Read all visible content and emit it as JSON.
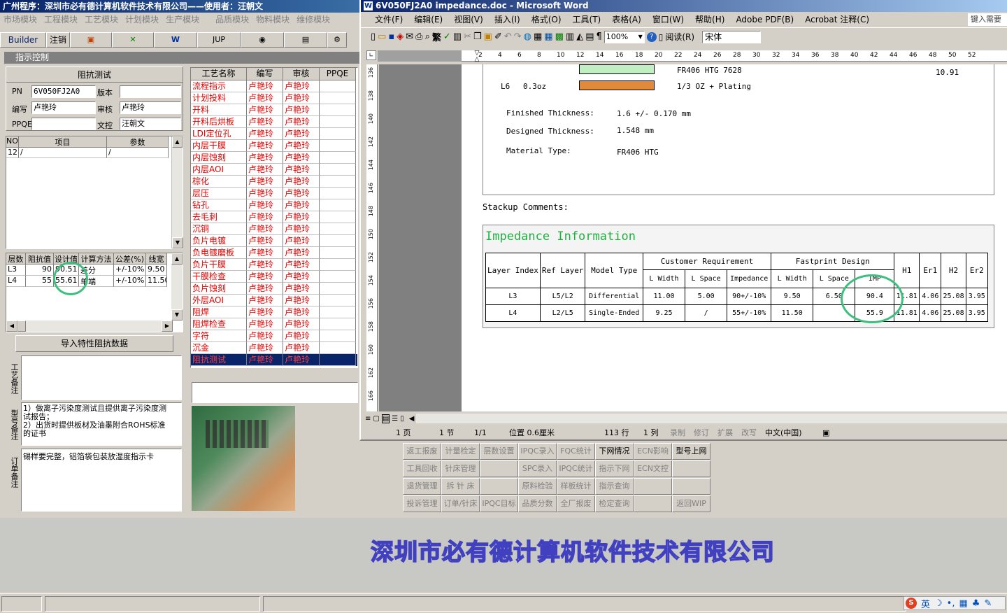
{
  "app": {
    "title": "广州程序：深圳市必有德计算机软件技术有限公司——使用者：汪朝文",
    "menu": [
      "市场模块",
      "工程模块",
      "工艺模块",
      "计划模块",
      "生产模块",
      "品质模块",
      "物料模块",
      "维修模块"
    ],
    "toolbar": {
      "builder": "Builder",
      "logout": "注销",
      "jup": "JUP"
    },
    "panel_title": "指示控制",
    "section_title": "阻抗测试",
    "fields": {
      "pn_label": "PN",
      "pn_value": "6V050FJ2A0",
      "version_label": "版本",
      "version_value": "",
      "writer_label": "编写",
      "writer_value": "卢艳玲",
      "reviewer_label": "审核",
      "reviewer_value": "卢艳玲",
      "ppqe_label": "PPQE",
      "ppqe_value": "",
      "controller_label": "文控",
      "controller_value": "汪朝文"
    },
    "items_grid": {
      "headers": [
        "NO",
        "项目",
        "参数"
      ],
      "rows": [
        [
          "12",
          "/",
          "/"
        ]
      ]
    },
    "imp_grid": {
      "headers": [
        "层数",
        "阻抗值",
        "设计值",
        "计算方法",
        "公差(%)",
        "线宽"
      ],
      "rows": [
        [
          "L3",
          "90",
          "90.51",
          "差分",
          "+/-10%",
          "9.50"
        ],
        [
          "L4",
          "55",
          "55.61",
          "单端",
          "+/-10%",
          "11.50"
        ]
      ]
    },
    "import_button": "导入特性阻抗数据",
    "side_labels": {
      "process": "工艺备注",
      "model": "型号备注",
      "order": "订单备注"
    },
    "process_note": "",
    "model_note": "1）做离子污染度测试且提供离子污染度测试报告；\n2）出货时提供板材及油墨附合ROHS标准的证书",
    "order_note": "锡样要完整，铝箔袋包装放湿度指示卡",
    "process_list": {
      "headers": [
        "工艺名称",
        "编写",
        "审核",
        "PPQE"
      ],
      "rows": [
        [
          "流程指示",
          "卢艳玲",
          "卢艳玲"
        ],
        [
          "计划投料",
          "卢艳玲",
          "卢艳玲"
        ],
        [
          "开料",
          "卢艳玲",
          "卢艳玲"
        ],
        [
          "开料后烘板",
          "卢艳玲",
          "卢艳玲"
        ],
        [
          "LDI定位孔",
          "卢艳玲",
          "卢艳玲"
        ],
        [
          "内层干膜",
          "卢艳玲",
          "卢艳玲"
        ],
        [
          "内层蚀刻",
          "卢艳玲",
          "卢艳玲"
        ],
        [
          "内层AOI",
          "卢艳玲",
          "卢艳玲"
        ],
        [
          "棕化",
          "卢艳玲",
          "卢艳玲"
        ],
        [
          "层压",
          "卢艳玲",
          "卢艳玲"
        ],
        [
          "钻孔",
          "卢艳玲",
          "卢艳玲"
        ],
        [
          "去毛刺",
          "卢艳玲",
          "卢艳玲"
        ],
        [
          "沉铜",
          "卢艳玲",
          "卢艳玲"
        ],
        [
          "负片电镀",
          "卢艳玲",
          "卢艳玲"
        ],
        [
          "负电镀磨板",
          "卢艳玲",
          "卢艳玲"
        ],
        [
          "负片干膜",
          "卢艳玲",
          "卢艳玲"
        ],
        [
          "干膜检查",
          "卢艳玲",
          "卢艳玲"
        ],
        [
          "负片蚀刻",
          "卢艳玲",
          "卢艳玲"
        ],
        [
          "外层AOI",
          "卢艳玲",
          "卢艳玲"
        ],
        [
          "阻焊",
          "卢艳玲",
          "卢艳玲"
        ],
        [
          "阻焊检查",
          "卢艳玲",
          "卢艳玲"
        ],
        [
          "字符",
          "卢艳玲",
          "卢艳玲"
        ],
        [
          "沉金",
          "卢艳玲",
          "卢艳玲"
        ],
        [
          "阻抗测试",
          "卢艳玲",
          "卢艳玲"
        ]
      ]
    },
    "bottom_buttons": [
      [
        "返工报废",
        "计量检定",
        "层数设置",
        "IPQC录入",
        "FQC统计",
        "下网情况",
        "ECN影响",
        "型号上网"
      ],
      [
        "工具回收",
        "针床管理",
        "",
        "SPC录入",
        "IPQC统计",
        "指示下网",
        "ECN文控",
        ""
      ],
      [
        "退货管理",
        "拆 针 床",
        "",
        "原料检验",
        "样板统计",
        "指示查询",
        "",
        ""
      ],
      [
        "投诉管理",
        "订单/针床",
        "IPQC目标",
        "品质分数",
        "全厂报废",
        "检定查询",
        "",
        "返回WIP"
      ]
    ],
    "company_banner": "深圳市必有德计算机软件技术有限公司"
  },
  "word": {
    "title": "6V050FJ2A0 impedance.doc - Microsoft Word",
    "menu": [
      "文件(F)",
      "编辑(E)",
      "视图(V)",
      "插入(I)",
      "格式(O)",
      "工具(T)",
      "表格(A)",
      "窗口(W)",
      "帮助(H)",
      "Adobe PDF(B)",
      "Acrobat 注释(C)"
    ],
    "help_box": "键入需要",
    "zoom": "100%",
    "read_label": "阅读(R)",
    "font": "宋体",
    "ruler": [
      "2",
      "4",
      "6",
      "8",
      "10",
      "12",
      "14",
      "16",
      "18",
      "20",
      "22",
      "24",
      "26",
      "28",
      "30",
      "32",
      "34",
      "36",
      "38",
      "40",
      "42",
      "44",
      "46",
      "48",
      "50",
      "52"
    ],
    "vruler": [
      "136",
      "138",
      "140",
      "142",
      "144",
      "146",
      "148",
      "150",
      "152",
      "154",
      "156",
      "158",
      "160",
      "162",
      "166"
    ],
    "doc": {
      "row_fr406": "FR406  HTG  7628",
      "value_1091": "10.91",
      "l6_label": "L6",
      "l6_oz": "0.3oz",
      "plating": "1/3 OZ + Plating",
      "finished_label": "Finished Thickness:",
      "finished_value": "1.6 +/- 0.170 mm",
      "designed_label": "Designed Thickness:",
      "designed_value": "1.548 mm",
      "material_label": "Material   Type:",
      "material_value": "FR406  HTG",
      "stackup_comments": "Stackup Comments:",
      "impedance_title": "Impedance Information",
      "table": {
        "h_layer": "Layer Index",
        "h_ref": "Ref Layer",
        "h_model": "Model Type",
        "h_cust": "Customer Requirement",
        "h_fast": "Fastprint Design",
        "h_lw": "L Width",
        "h_ls": "L Space",
        "h_imp": "Impedance",
        "h_lw2": "L Width",
        "h_ls2": "L Space",
        "h_imp2": "IMP",
        "h_h1": "H1",
        "h_er1": "Er1",
        "h_h2": "H2",
        "h_er2": "Er2",
        "rows": [
          [
            "L3",
            "L5/L2",
            "Differential",
            "11.00",
            "5.00",
            "90+/-10%",
            "9.50",
            "6.50",
            "90.4",
            "11.81",
            "4.06",
            "25.08",
            "3.95"
          ],
          [
            "L4",
            "L2/L5",
            "Single-Ended",
            "9.25",
            "/",
            "55+/-10%",
            "11.50",
            "",
            "55.9",
            "11.81",
            "4.06",
            "25.08",
            "3.95"
          ]
        ]
      }
    },
    "status": {
      "page": "1 页",
      "section": "1 节",
      "pages": "1/1",
      "position": "位置 0.6厘米",
      "line": "113 行",
      "col": "1 列",
      "rec": "录制",
      "trk": "修订",
      "ext": "扩展",
      "ovr": "改写",
      "lang": "中文(中国)"
    }
  },
  "tray": {
    "ime": "英"
  }
}
